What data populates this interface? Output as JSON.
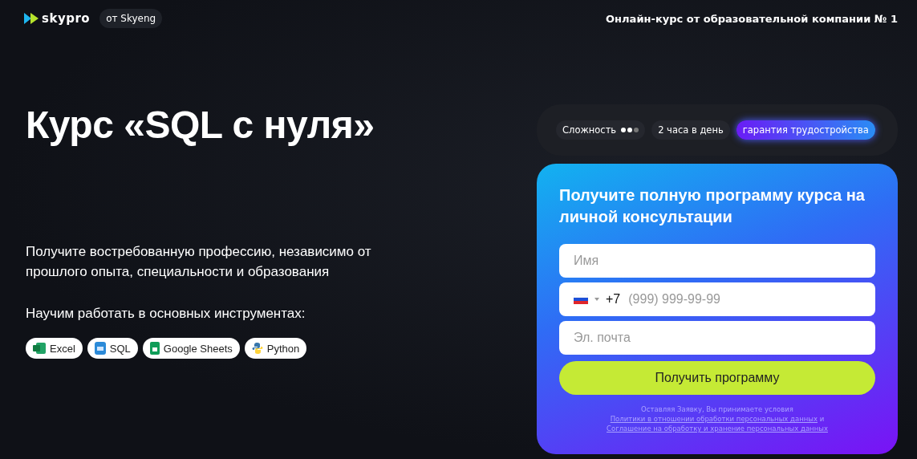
{
  "header": {
    "logo": "skypro",
    "badge": "от Skyeng",
    "tagline": "Онлайн-курс от образовательной компании № 1"
  },
  "hero": {
    "title": "Курс «SQL с нуля»",
    "subtitle": "Получите востребованную профессию, независимо от прошлого опыта, специальности и образования",
    "tools_heading": "Научим работать в основных инструментах:",
    "tools": [
      {
        "kind": "excel",
        "label": "Excel"
      },
      {
        "kind": "sql",
        "label": "SQL"
      },
      {
        "kind": "sheets",
        "label": "Google Sheets"
      },
      {
        "kind": "python",
        "label": "Python"
      }
    ]
  },
  "features": {
    "difficulty": {
      "label": "Сложность",
      "stars": 2
    },
    "hours": "2 часа в день",
    "guarantee": "гарантия трудостройства"
  },
  "form": {
    "title": "Получите полную программу курса на личной консультации",
    "name_placeholder": "Имя",
    "phone_code": "+7",
    "phone_placeholder": "(999) 999-99-99",
    "email_placeholder": "Эл. почта",
    "submit": "Получить программу",
    "legal": {
      "before": "Оставляя Заявку, Вы принимаете условия",
      "link_1": "Политики в отношении обработки персональных данных",
      "middle": "и",
      "link_2": "Соглашение на обработку и хранение персональных данных"
    }
  }
}
